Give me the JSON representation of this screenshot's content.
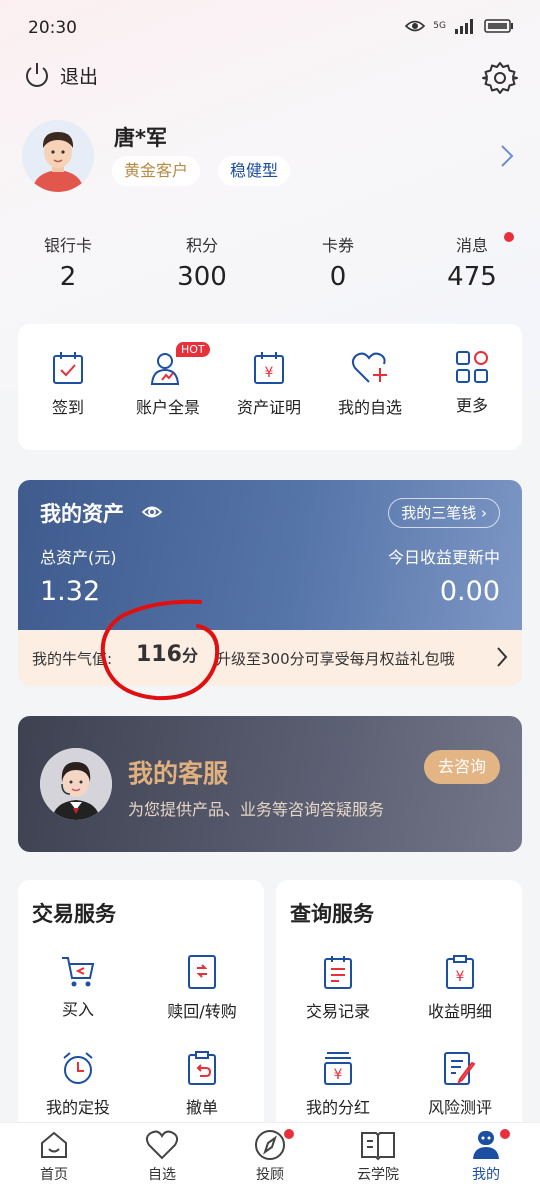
{
  "status": {
    "time": "20:30",
    "network": "5G"
  },
  "topbar": {
    "logout_label": "退出"
  },
  "profile": {
    "name": "唐*军",
    "tag_level": "黄金客户",
    "tag_risk": "稳健型"
  },
  "stats": [
    {
      "label": "银行卡",
      "value": "2"
    },
    {
      "label": "积分",
      "value": "300"
    },
    {
      "label": "卡券",
      "value": "0"
    },
    {
      "label": "消息",
      "value": "475"
    }
  ],
  "quick": [
    {
      "label": "签到",
      "icon": "calendar-check-icon"
    },
    {
      "label": "账户全景",
      "icon": "user-chart-icon",
      "badge": "HOT"
    },
    {
      "label": "资产证明",
      "icon": "yuan-calendar-icon"
    },
    {
      "label": "我的自选",
      "icon": "heart-plus-icon"
    },
    {
      "label": "更多",
      "icon": "grid-icon"
    }
  ],
  "assets": {
    "title": "我的资产",
    "three_money": "我的三笔钱",
    "total_label": "总资产(元)",
    "total_value": "1.32",
    "today_label": "今日收益更新中",
    "today_value": "0.00"
  },
  "bull": {
    "label": "我的牛气值:",
    "value": "116",
    "unit": "分",
    "tip": "升级至300分可享受每月权益礼包哦"
  },
  "service": {
    "title": "我的客服",
    "subtitle": "为您提供产品、业务等咨询答疑服务",
    "button": "去咨询"
  },
  "trade": {
    "title": "交易服务",
    "items": [
      {
        "label": "买入",
        "icon": "cart-icon"
      },
      {
        "label": "赎回/转购",
        "icon": "exchange-doc-icon"
      },
      {
        "label": "我的定投",
        "icon": "alarm-clock-icon"
      },
      {
        "label": "撤单",
        "icon": "undo-clipboard-icon"
      }
    ]
  },
  "query": {
    "title": "查询服务",
    "items": [
      {
        "label": "交易记录",
        "icon": "record-icon"
      },
      {
        "label": "收益明细",
        "icon": "yuan-clipboard-icon"
      },
      {
        "label": "我的分红",
        "icon": "dividend-icon"
      },
      {
        "label": "风险测评",
        "icon": "risk-test-icon"
      }
    ]
  },
  "tabs": [
    {
      "label": "首页",
      "icon": "home-icon"
    },
    {
      "label": "自选",
      "icon": "heart-icon"
    },
    {
      "label": "投顾",
      "icon": "compass-icon"
    },
    {
      "label": "云学院",
      "icon": "book-icon"
    },
    {
      "label": "我的",
      "icon": "user-icon",
      "active": true
    }
  ],
  "colors": {
    "accent": "#1c4fa1",
    "red": "#e8303a",
    "gold": "#b78a45"
  }
}
